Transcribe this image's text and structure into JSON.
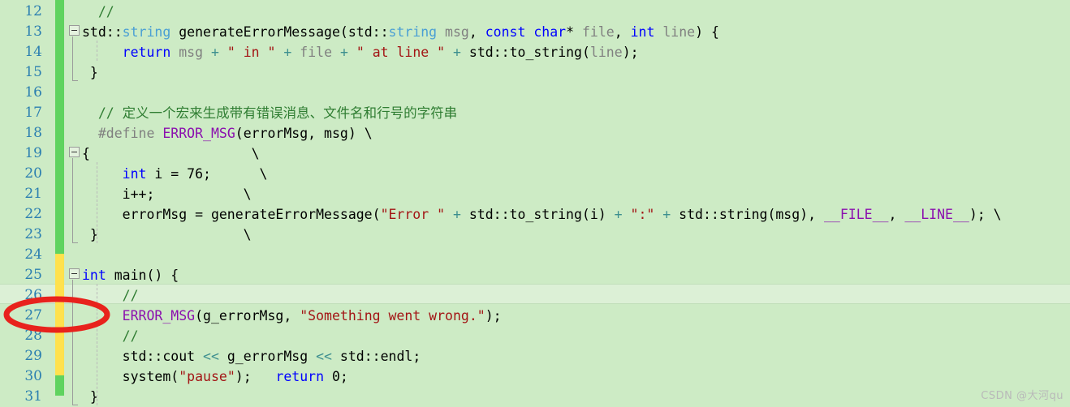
{
  "editor": {
    "background_color": "#cdebc5",
    "current_line_number": 26,
    "first_visible_line": 12,
    "line_height": 25,
    "watermark": "CSDN @大河qu"
  },
  "gutter": {
    "line_numbers": [
      "12",
      "13",
      "14",
      "15",
      "16",
      "17",
      "18",
      "19",
      "20",
      "21",
      "22",
      "23",
      "24",
      "25",
      "26",
      "27",
      "28",
      "29",
      "30",
      "31"
    ],
    "change_bar": [
      {
        "from_line": 12,
        "to_line": 24,
        "color": "#5fd35f",
        "state": "saved"
      },
      {
        "from_line": 25,
        "to_line": 30,
        "color": "#ffe14d",
        "state": "modified"
      },
      {
        "from_line": 31,
        "to_line": 31,
        "color": "#5fd35f",
        "state": "saved"
      }
    ]
  },
  "folding": {
    "markers": [
      {
        "line": 13,
        "glyph": "minus",
        "label": "collapse-function-generateErrorMessage"
      },
      {
        "line": 19,
        "glyph": "minus",
        "label": "collapse-macro-block"
      },
      {
        "line": 25,
        "glyph": "minus",
        "label": "collapse-function-main"
      }
    ]
  },
  "annotation": {
    "type": "red-ellipse",
    "color": "#e8221c",
    "stroke_width": 7,
    "target_line": 27
  },
  "code": {
    "language": "cpp",
    "lines": [
      {
        "number": 12,
        "tokens": [
          {
            "t": "  ",
            "c": "plain"
          },
          {
            "t": "//",
            "c": "cmt"
          }
        ]
      },
      {
        "number": 13,
        "tokens": [
          {
            "t": "std::",
            "c": "plain"
          },
          {
            "t": "string",
            "c": "type"
          },
          {
            "t": " generateErrorMessage(",
            "c": "plain"
          },
          {
            "t": "std::",
            "c": "plain"
          },
          {
            "t": "string",
            "c": "type"
          },
          {
            "t": " ",
            "c": "plain"
          },
          {
            "t": "msg",
            "c": "param"
          },
          {
            "t": ", ",
            "c": "plain"
          },
          {
            "t": "const",
            "c": "kw"
          },
          {
            "t": " ",
            "c": "plain"
          },
          {
            "t": "char",
            "c": "kw"
          },
          {
            "t": "* ",
            "c": "plain"
          },
          {
            "t": "file",
            "c": "param"
          },
          {
            "t": ", ",
            "c": "plain"
          },
          {
            "t": "int",
            "c": "kw"
          },
          {
            "t": " ",
            "c": "plain"
          },
          {
            "t": "line",
            "c": "param"
          },
          {
            "t": ") {",
            "c": "plain"
          }
        ]
      },
      {
        "number": 14,
        "tokens": [
          {
            "t": "     ",
            "c": "plain"
          },
          {
            "t": "return",
            "c": "kw"
          },
          {
            "t": " ",
            "c": "plain"
          },
          {
            "t": "msg",
            "c": "param"
          },
          {
            "t": " ",
            "c": "plain"
          },
          {
            "t": "+",
            "c": "op"
          },
          {
            "t": " ",
            "c": "plain"
          },
          {
            "t": "\" in \"",
            "c": "str"
          },
          {
            "t": " ",
            "c": "plain"
          },
          {
            "t": "+",
            "c": "op"
          },
          {
            "t": " ",
            "c": "plain"
          },
          {
            "t": "file",
            "c": "param"
          },
          {
            "t": " ",
            "c": "plain"
          },
          {
            "t": "+",
            "c": "op"
          },
          {
            "t": " ",
            "c": "plain"
          },
          {
            "t": "\" at line \"",
            "c": "str"
          },
          {
            "t": " ",
            "c": "plain"
          },
          {
            "t": "+",
            "c": "op"
          },
          {
            "t": " std::to_string(",
            "c": "plain"
          },
          {
            "t": "line",
            "c": "param"
          },
          {
            "t": ");",
            "c": "plain"
          }
        ]
      },
      {
        "number": 15,
        "tokens": [
          {
            "t": " }",
            "c": "plain"
          }
        ]
      },
      {
        "number": 16,
        "tokens": []
      },
      {
        "number": 17,
        "tokens": [
          {
            "t": "  ",
            "c": "plain"
          },
          {
            "t": "// 定义一个宏来生成带有错误消息、文件名和行号的字符串",
            "c": "cmt"
          }
        ]
      },
      {
        "number": 18,
        "tokens": [
          {
            "t": "  ",
            "c": "plain"
          },
          {
            "t": "#define",
            "c": "pre"
          },
          {
            "t": " ",
            "c": "plain"
          },
          {
            "t": "ERROR_MSG",
            "c": "macro"
          },
          {
            "t": "(errorMsg, msg) \\",
            "c": "plain"
          }
        ]
      },
      {
        "number": 19,
        "tokens": [
          {
            "t": "{                    \\",
            "c": "plain"
          }
        ]
      },
      {
        "number": 20,
        "tokens": [
          {
            "t": "     ",
            "c": "plain"
          },
          {
            "t": "int",
            "c": "kw"
          },
          {
            "t": " i = 76;      \\",
            "c": "plain"
          }
        ]
      },
      {
        "number": 21,
        "tokens": [
          {
            "t": "     i++;           \\",
            "c": "plain"
          }
        ]
      },
      {
        "number": 22,
        "tokens": [
          {
            "t": "     errorMsg = generateErrorMessage(",
            "c": "plain"
          },
          {
            "t": "\"Error \"",
            "c": "str"
          },
          {
            "t": " ",
            "c": "plain"
          },
          {
            "t": "+",
            "c": "op"
          },
          {
            "t": " std::to_string(i) ",
            "c": "plain"
          },
          {
            "t": "+",
            "c": "op"
          },
          {
            "t": " ",
            "c": "plain"
          },
          {
            "t": "\":\"",
            "c": "str"
          },
          {
            "t": " ",
            "c": "plain"
          },
          {
            "t": "+",
            "c": "op"
          },
          {
            "t": " std::string(msg), ",
            "c": "plain"
          },
          {
            "t": "__FILE__",
            "c": "macro"
          },
          {
            "t": ", ",
            "c": "plain"
          },
          {
            "t": "__LINE__",
            "c": "macro"
          },
          {
            "t": "); \\",
            "c": "plain"
          }
        ]
      },
      {
        "number": 23,
        "tokens": [
          {
            "t": " }                  \\",
            "c": "plain"
          }
        ]
      },
      {
        "number": 24,
        "tokens": []
      },
      {
        "number": 25,
        "tokens": [
          {
            "t": "int",
            "c": "kw"
          },
          {
            "t": " main() {",
            "c": "plain"
          }
        ]
      },
      {
        "number": 26,
        "tokens": [
          {
            "t": "     ",
            "c": "plain"
          },
          {
            "t": "//",
            "c": "cmt"
          }
        ]
      },
      {
        "number": 27,
        "tokens": [
          {
            "t": "     ",
            "c": "plain"
          },
          {
            "t": "ERROR_MSG",
            "c": "macro"
          },
          {
            "t": "(g_errorMsg, ",
            "c": "plain"
          },
          {
            "t": "\"Something went wrong.\"",
            "c": "str"
          },
          {
            "t": ");",
            "c": "plain"
          }
        ]
      },
      {
        "number": 28,
        "tokens": [
          {
            "t": "     ",
            "c": "plain"
          },
          {
            "t": "//",
            "c": "cmt"
          }
        ]
      },
      {
        "number": 29,
        "tokens": [
          {
            "t": "     std::cout ",
            "c": "plain"
          },
          {
            "t": "<<",
            "c": "op"
          },
          {
            "t": " g_errorMsg ",
            "c": "plain"
          },
          {
            "t": "<<",
            "c": "op"
          },
          {
            "t": " std::endl;",
            "c": "plain"
          }
        ]
      },
      {
        "number": 30,
        "tokens": [
          {
            "t": "     system(",
            "c": "plain"
          },
          {
            "t": "\"pause\"",
            "c": "str"
          },
          {
            "t": ");   ",
            "c": "plain"
          },
          {
            "t": "return",
            "c": "kw"
          },
          {
            "t": " 0;",
            "c": "plain"
          }
        ]
      },
      {
        "number": 31,
        "tokens": [
          {
            "t": " }",
            "c": "plain"
          }
        ]
      }
    ]
  }
}
